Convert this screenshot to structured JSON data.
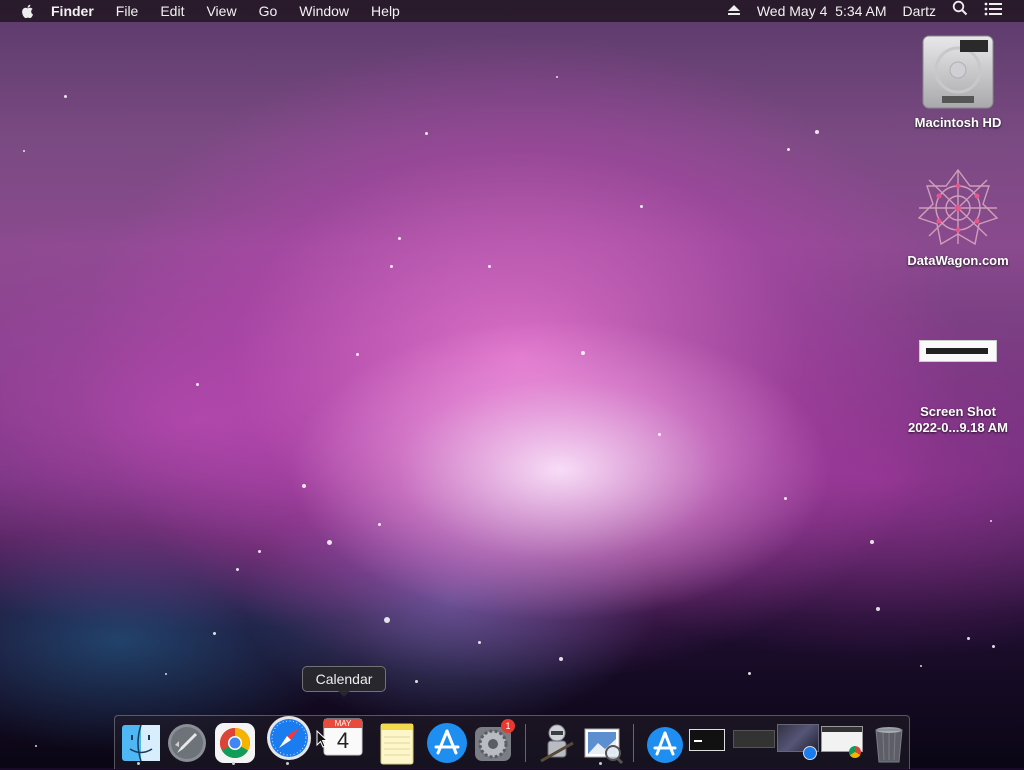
{
  "menubar": {
    "app_name": "Finder",
    "menus": [
      "File",
      "Edit",
      "View",
      "Go",
      "Window",
      "Help"
    ],
    "clock": "Wed May 4  5:34 AM",
    "user": "Dartz",
    "icons": [
      "apple-icon",
      "eject-icon",
      "spotlight-icon",
      "notification-center-icon"
    ]
  },
  "desktop": {
    "items": [
      {
        "label": "Macintosh HD",
        "icon": "hard-drive-icon"
      },
      {
        "label": "DataWagon.com",
        "icon": "datawagon-icon"
      },
      {
        "label_line1": "Screen Shot",
        "label_line2": "2022-0...9.18 AM",
        "icon": "screenshot-file-icon"
      }
    ]
  },
  "tooltip": {
    "text": "Calendar"
  },
  "dock": {
    "apps": [
      "Finder",
      "Launchpad",
      "Google Chrome",
      "Safari",
      "Calendar",
      "Notes",
      "App Store",
      "System Preferences",
      "Automator",
      "Preview"
    ],
    "calendar": {
      "month": "MAY",
      "day": "4"
    },
    "system_prefs_badge": "1",
    "stacks": [
      "Downloads",
      "Screen Shot 1",
      "Screen Shot 2",
      "Screen Shot 3",
      "Screen Shot 4"
    ],
    "trash": "Trash"
  },
  "colors": {
    "menubar_bg": "#1e141e",
    "accent_blue": "#1b7cf0",
    "badge_red": "#e8382f"
  }
}
